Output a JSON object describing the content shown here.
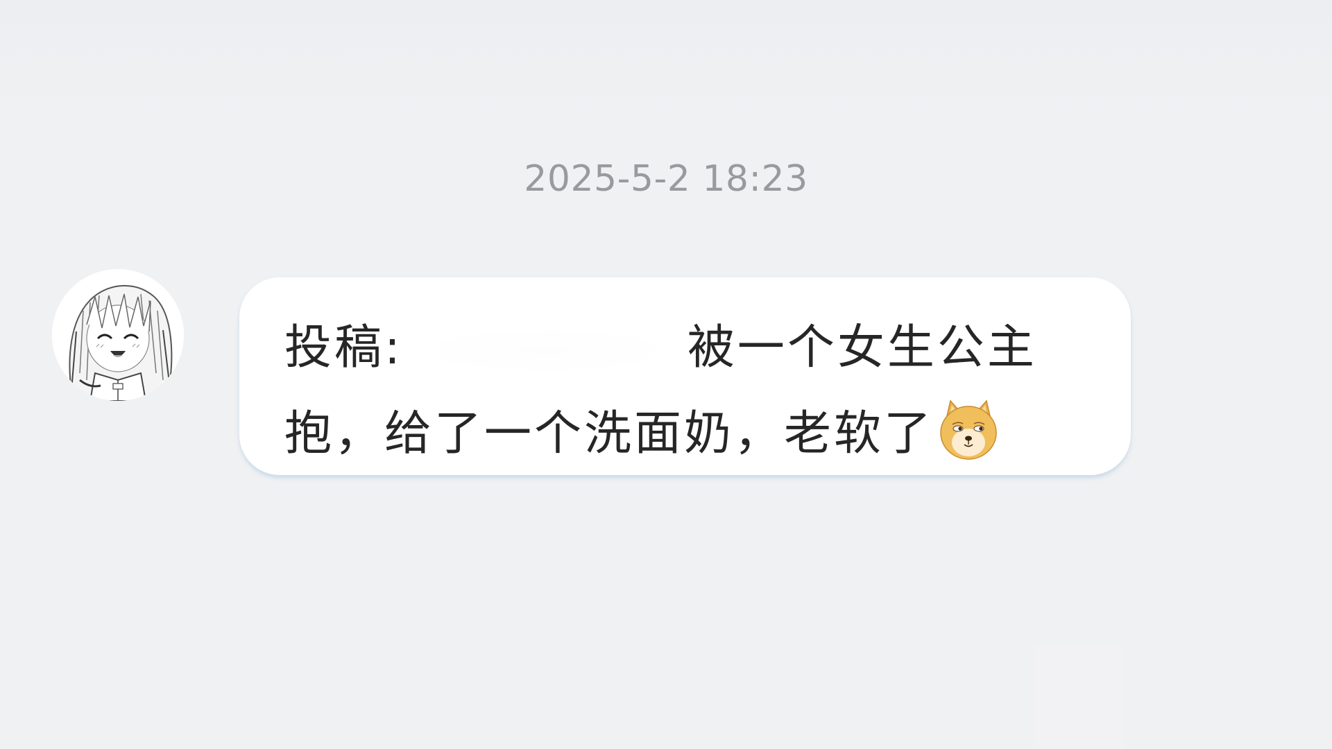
{
  "conversation": {
    "timestamp": "2025-5-2 18:23",
    "message": {
      "sender_avatar": "anime-girl-avatar",
      "prefix": "投稿:",
      "redacted": true,
      "line1_text": "被一个女生公主",
      "line2_text": "抱，给了一个洗面奶，老软了",
      "emoji": "doge-emoji"
    }
  },
  "colors": {
    "background": "#f0f1f3",
    "bubble": "#ffffff",
    "timestamp": "#9a9a9e",
    "message_text": "#262626"
  }
}
